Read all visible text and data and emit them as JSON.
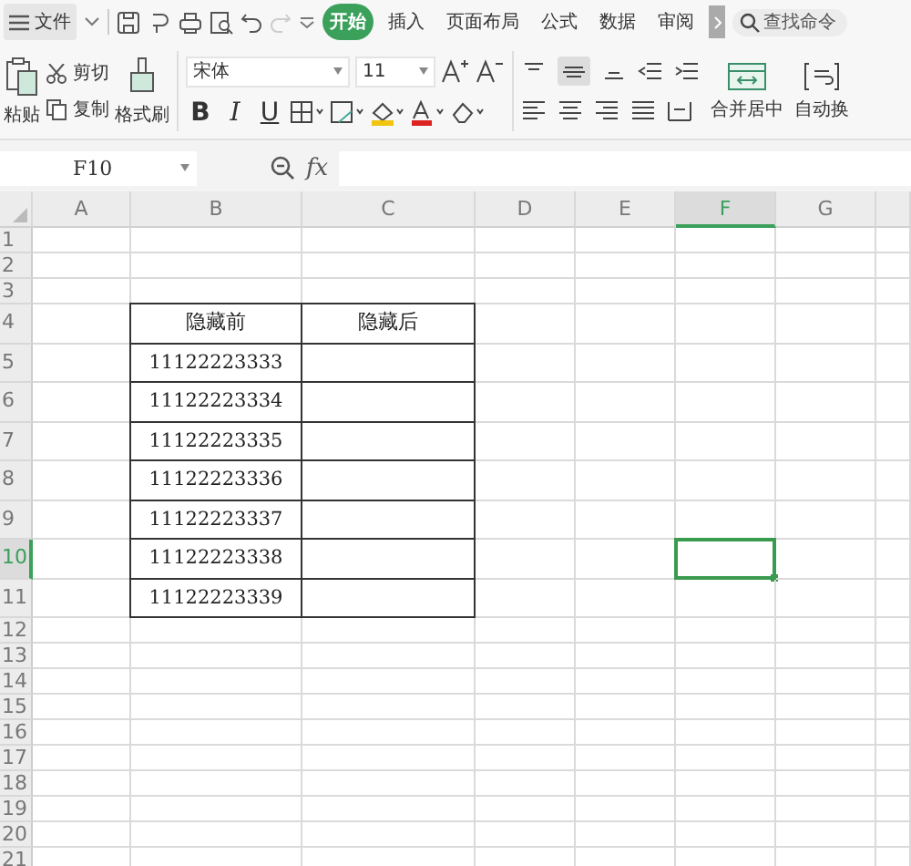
{
  "menu_bar": {
    "file_menu": "文件",
    "tabs": [
      {
        "label": "开始",
        "selected": true
      },
      {
        "label": "插入",
        "selected": false
      },
      {
        "label": "页面布局",
        "selected": false
      },
      {
        "label": "公式",
        "selected": false
      },
      {
        "label": "数据",
        "selected": false
      },
      {
        "label": "审阅",
        "selected": false
      }
    ],
    "search": {
      "placeholder": "查找命令"
    }
  },
  "ribbon": {
    "paste": "粘贴",
    "cut": "剪切",
    "copy": "复制",
    "format_painter": "格式刷",
    "font_name": "宋体",
    "font_size": "11",
    "bold": "B",
    "italic": "I",
    "underline": "U",
    "merge_center": "合并居中",
    "wrap_text": "自动换"
  },
  "formula_bar": {
    "name_box": "F10",
    "fx": "fx"
  },
  "sheet": {
    "columns": [
      {
        "label": "A",
        "selected": false
      },
      {
        "label": "B",
        "selected": false
      },
      {
        "label": "C",
        "selected": false
      },
      {
        "label": "D",
        "selected": false
      },
      {
        "label": "E",
        "selected": false
      },
      {
        "label": "F",
        "selected": true
      },
      {
        "label": "G",
        "selected": false
      }
    ],
    "rows": [
      {
        "label": "1",
        "selected": false
      },
      {
        "label": "2",
        "selected": false
      },
      {
        "label": "3",
        "selected": false
      },
      {
        "label": "4",
        "selected": false
      },
      {
        "label": "5",
        "selected": false
      },
      {
        "label": "6",
        "selected": false
      },
      {
        "label": "7",
        "selected": false
      },
      {
        "label": "8",
        "selected": false
      },
      {
        "label": "9",
        "selected": false
      },
      {
        "label": "10",
        "selected": true
      },
      {
        "label": "11",
        "selected": false
      },
      {
        "label": "12",
        "selected": false
      },
      {
        "label": "13",
        "selected": false
      },
      {
        "label": "14",
        "selected": false
      },
      {
        "label": "15",
        "selected": false
      },
      {
        "label": "16",
        "selected": false
      },
      {
        "label": "17",
        "selected": false
      },
      {
        "label": "18",
        "selected": false
      },
      {
        "label": "19",
        "selected": false
      },
      {
        "label": "20",
        "selected": false
      },
      {
        "label": "21",
        "selected": false
      }
    ],
    "table": {
      "header": [
        "隐藏前",
        "隐藏后"
      ],
      "values": [
        "11122223333",
        "11122223334",
        "11122223335",
        "11122223336",
        "11122223337",
        "11122223338",
        "11122223339"
      ]
    }
  }
}
